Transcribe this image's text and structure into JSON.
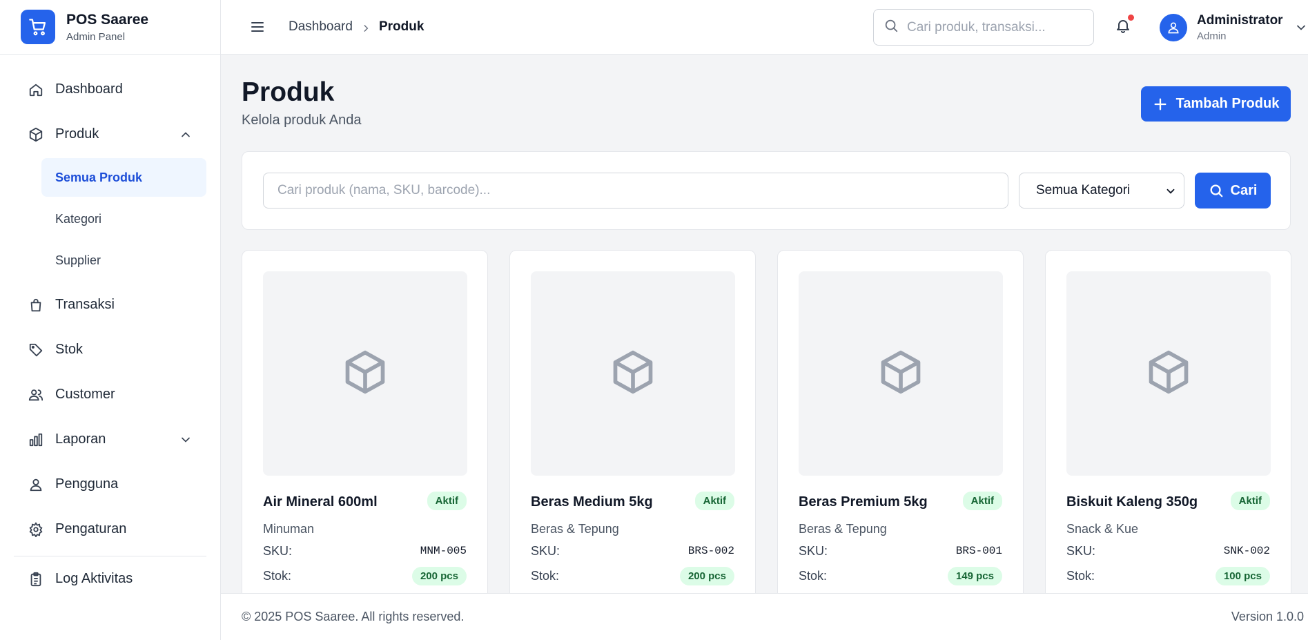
{
  "brand": {
    "title": "POS Saaree",
    "subtitle": "Admin Panel"
  },
  "sidebar": {
    "items": [
      {
        "label": "Dashboard",
        "icon": "home-icon"
      },
      {
        "label": "Produk",
        "icon": "box-icon",
        "expanded": true,
        "children": [
          {
            "label": "Semua Produk",
            "active": true
          },
          {
            "label": "Kategori"
          },
          {
            "label": "Supplier"
          }
        ]
      },
      {
        "label": "Transaksi",
        "icon": "shopping-bag-icon"
      },
      {
        "label": "Stok",
        "icon": "tag-icon"
      },
      {
        "label": "Customer",
        "icon": "users-icon"
      },
      {
        "label": "Laporan",
        "icon": "bar-chart-icon",
        "expanded": false
      },
      {
        "label": "Pengguna",
        "icon": "user-icon"
      },
      {
        "label": "Pengaturan",
        "icon": "gear-icon"
      },
      {
        "label": "Log Aktivitas",
        "icon": "clipboard-icon"
      }
    ]
  },
  "topbar": {
    "breadcrumb": [
      "Dashboard",
      "Produk"
    ],
    "search_placeholder": "Cari produk, transaksi...",
    "user": {
      "name": "Administrator",
      "role": "Admin"
    }
  },
  "page": {
    "title": "Produk",
    "subtitle": "Kelola produk Anda",
    "add_button": "Tambah Produk"
  },
  "filter": {
    "search_placeholder": "Cari produk (nama, SKU, barcode)...",
    "category_selected": "Semua Kategori",
    "search_button": "Cari"
  },
  "products": [
    {
      "name": "Air Mineral 600ml",
      "status": "Aktif",
      "category": "Minuman",
      "sku_label": "SKU:",
      "sku": "MNM-005",
      "stock_label": "Stok:",
      "stock": "200 pcs"
    },
    {
      "name": "Beras Medium 5kg",
      "status": "Aktif",
      "category": "Beras & Tepung",
      "sku_label": "SKU:",
      "sku": "BRS-002",
      "stock_label": "Stok:",
      "stock": "200 pcs"
    },
    {
      "name": "Beras Premium 5kg",
      "status": "Aktif",
      "category": "Beras & Tepung",
      "sku_label": "SKU:",
      "sku": "BRS-001",
      "stock_label": "Stok:",
      "stock": "149 pcs"
    },
    {
      "name": "Biskuit Kaleng 350g",
      "status": "Aktif",
      "category": "Snack & Kue",
      "sku_label": "SKU:",
      "sku": "SNK-002",
      "stock_label": "Stok:",
      "stock": "100 pcs"
    }
  ],
  "footer": {
    "copyright": "© 2025 POS Saaree. All rights reserved.",
    "version": "Version 1.0.0"
  },
  "colors": {
    "accent": "#2563eb",
    "badge_bg": "#dcfce7",
    "badge_text": "#166534",
    "notification": "#ef4444"
  }
}
